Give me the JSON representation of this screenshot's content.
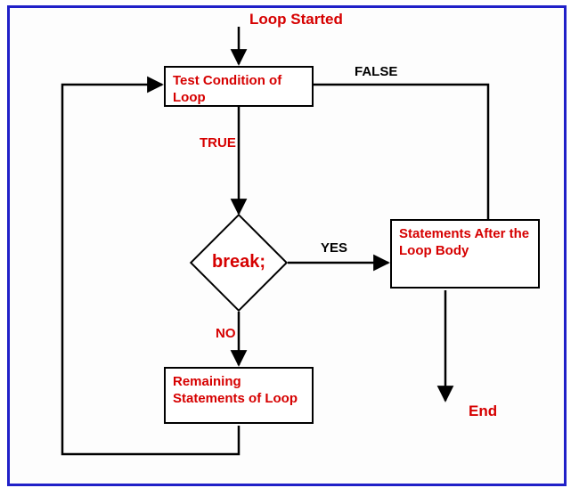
{
  "flow": {
    "start_label": "Loop Started",
    "test_box": "Test Condition of Loop",
    "true_label": "TRUE",
    "false_label": "FALSE",
    "decision_label": "break;",
    "yes_label": "YES",
    "no_label": "NO",
    "after_box": "Statements After the Loop Body",
    "remaining_box": "Remaining Statements of Loop",
    "end_label": "End"
  },
  "chart_data": {
    "type": "flowchart",
    "nodes": [
      {
        "id": "start",
        "kind": "terminator",
        "label": "Loop Started"
      },
      {
        "id": "test",
        "kind": "process",
        "label": "Test Condition of Loop"
      },
      {
        "id": "decision",
        "kind": "decision",
        "label": "break;"
      },
      {
        "id": "remaining",
        "kind": "process",
        "label": "Remaining Statements of Loop"
      },
      {
        "id": "after",
        "kind": "process",
        "label": "Statements After the Loop Body"
      },
      {
        "id": "end",
        "kind": "terminator",
        "label": "End"
      }
    ],
    "edges": [
      {
        "from": "start",
        "to": "test",
        "label": ""
      },
      {
        "from": "test",
        "to": "decision",
        "label": "TRUE"
      },
      {
        "from": "test",
        "to": "after",
        "label": "FALSE"
      },
      {
        "from": "decision",
        "to": "after",
        "label": "YES"
      },
      {
        "from": "decision",
        "to": "remaining",
        "label": "NO"
      },
      {
        "from": "remaining",
        "to": "test",
        "label": ""
      },
      {
        "from": "after",
        "to": "end",
        "label": ""
      }
    ]
  }
}
